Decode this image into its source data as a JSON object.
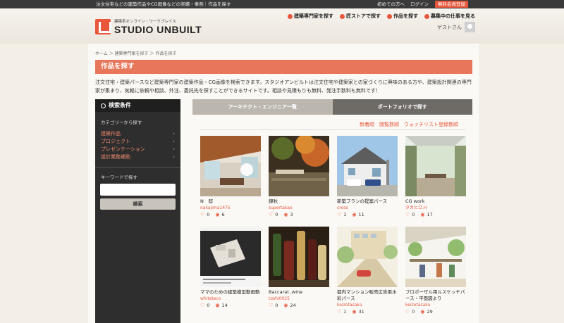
{
  "topbar": {
    "tagline": "注文住宅などの建築作品やCG画像などの実績・事例｜作品を探す",
    "link1": "初めての方へ",
    "link2": "ログイン",
    "member": "無料会員登録"
  },
  "header": {
    "logo_sub": "建築系オンライン・ワークプレイス",
    "logo_main": "STUDIO UNBUILT",
    "nav": [
      "建築専門家を探す",
      "匠ストアで探す",
      "作品を探す",
      "募集中の仕事を見る"
    ],
    "guest": "ゲストさん"
  },
  "breadcrumb": "ホーム ＞ 建築専門家を探す ＞ 作品を探す",
  "page_title": "作品を探す",
  "intro": "注文住宅・建築パースなど建築専門家の建築作品・CG画像を検索できます。スタジオアンビルトは注文住宅や建築家との家づくりに興味のある方や、建築設計関連の専門家が集まり、気軽に依頼や相談、外注、委託先を探すことができるサイトです。相談や見積もりも無料、発注手数料も無料です！",
  "sidebar": {
    "heading": "検索条件",
    "category_label": "カテゴリーから探す",
    "categories": [
      "建築作品",
      "プロジェクト",
      "プレゼンテーション",
      "設計業務補助"
    ],
    "keyword_label": "キーワードで探す",
    "search_button": "検索"
  },
  "tabs": [
    "アーキテクト・エンジニア一覧",
    "ポートフォリオで探す"
  ],
  "sort_options": [
    "新着順",
    "閲覧数順",
    "ウォッチリスト登録数順"
  ],
  "colors": {
    "accent": "#e8563c",
    "title_bar": "#e8765a",
    "sidebar": "#2e2e2e"
  },
  "works": [
    {
      "title": "N　邸",
      "user": "nakajima1475",
      "likes": "0",
      "views": "6"
    },
    {
      "title": "錦秋",
      "user": "supertakao",
      "likes": "0",
      "views": "3"
    },
    {
      "title": "新築プランの提案パース",
      "user": "cross",
      "likes": "1",
      "views": "11"
    },
    {
      "title": "CG work",
      "user": "タカヒロ.H",
      "likes": "0",
      "views": "17"
    },
    {
      "title": "ママのための建築模型動画動",
      "user": "whiteteco",
      "likes": "0",
      "views": "14"
    },
    {
      "title": "Baccarat ,wine",
      "user": "toshi0025",
      "likes": "0",
      "views": "24"
    },
    {
      "title": "都内マンション販売広告用水彩パース",
      "user": "keizotasaka",
      "likes": "1",
      "views": "31"
    },
    {
      "title": "プロポーザル用ルスケッチパース・平面図より",
      "user": "keizotasaka",
      "likes": "0",
      "views": "29"
    }
  ]
}
